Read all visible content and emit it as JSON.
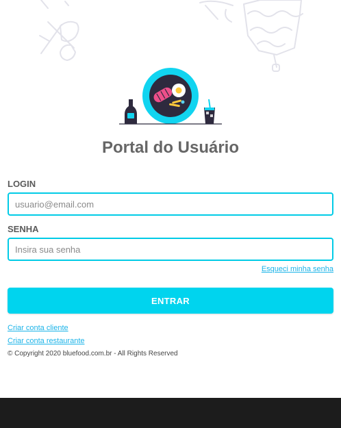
{
  "title": "Portal do Usuário",
  "login": {
    "label": "LOGIN",
    "placeholder": "usuario@email.com",
    "value": ""
  },
  "password": {
    "label": "SENHA",
    "placeholder": "Insira sua senha",
    "value": ""
  },
  "forgot_password": "Esqueci minha senha",
  "submit_label": "ENTRAR",
  "links": {
    "create_client": "Criar conta cliente",
    "create_restaurant": "Criar conta restaurante"
  },
  "copyright": "© Copyright 2020 bluefood.com.br - All Rights Reserved",
  "colors": {
    "accent": "#00d4ee",
    "input_border": "#00cbe6",
    "link": "#1ab3e8",
    "title": "#666666",
    "footer": "#1c1c1c",
    "doodle": "#e6e6ec"
  },
  "icons": {
    "logo": "food-plate-with-bottle-and-drink",
    "background_left": "fork-and-spoon-doodle",
    "background_right": "spatula-and-cake-doodle"
  }
}
